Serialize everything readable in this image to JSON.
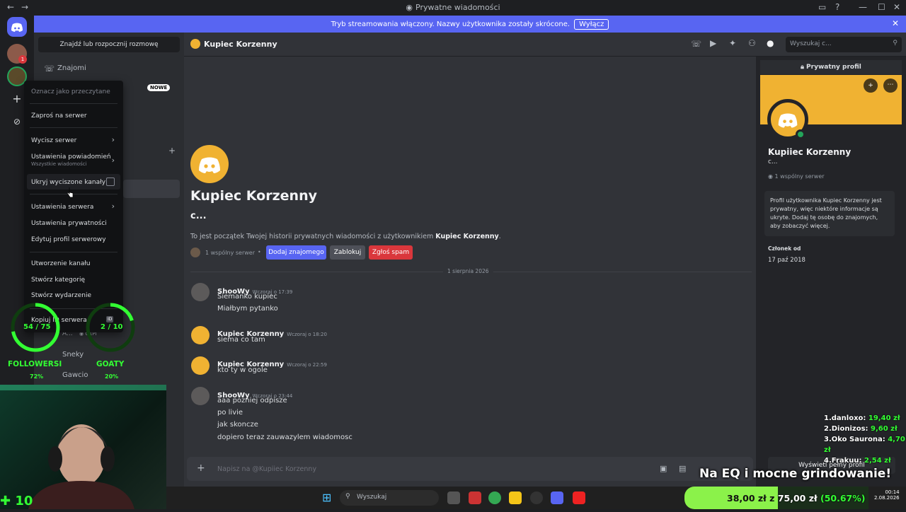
{
  "window": {
    "title": "Prywatne wiadomości"
  },
  "banner": {
    "text": "Tryb streamowania włączony. Nazwy użytkownika zostały skrócone.",
    "button": "Wyłącz"
  },
  "sidebar": {
    "search_button": "Znajdź lub rozpocznij rozmowę",
    "friends_label": "Znajomi",
    "new_badge": "NOWE",
    "list_users": [
      "A...",
      "Sneky",
      "Gawcio"
    ],
    "user_tag": "Q1PI"
  },
  "context_menu": {
    "mark_read": "Oznacz jako przeczytane",
    "invite": "Zaproś na serwer",
    "mute": "Wycisz serwer",
    "notifications": "Ustawienia powiadomień",
    "notifications_sub": "Wszystkie wiadomości",
    "hide_muted": "Ukryj wyciszone kanały",
    "server_settings": "Ustawienia serwera",
    "privacy": "Ustawienia prywatności",
    "edit_profile": "Edytuj profil serwerowy",
    "create_channel": "Utworzenie kanału",
    "create_category": "Stwórz kategorię",
    "create_event": "Stwórz wydarzenie",
    "copy_id": "Kopiuj ID serwera",
    "id_badge": "ID"
  },
  "header": {
    "name": "Kupiec Korzenny",
    "search_placeholder": "Wyszukaj c..."
  },
  "chat": {
    "intro_name": "Kupiec Korzenny",
    "intro_sub": "c...",
    "intro_text_prefix": "To jest początek Twojej historii prywatnych wiadomości z użytkownikiem ",
    "intro_text_name": "Kupiec Korzenny",
    "intro_text_suffix": ".",
    "mutual": "1 wspólny serwer",
    "add_friend": "Dodaj znajomego",
    "block": "Zablokuj",
    "report_spam": "Zgłoś spam",
    "date_divider": "1 sierpnia 2026",
    "messages": [
      {
        "author": "ShooWy",
        "time": "Wczoraj o 17:39",
        "lines": [
          "Siemanko kupiec",
          "Miałbym pytanko"
        ],
        "avatar": "user"
      },
      {
        "author": "Kupiec Korzenny",
        "time": "Wczoraj o 18:20",
        "lines": [
          "siema co tam"
        ],
        "avatar": "discord"
      },
      {
        "author": "Kupiec Korzenny",
        "time": "Wczoraj o 22:59",
        "lines": [
          "kto ty w ogole"
        ],
        "avatar": "discord"
      },
      {
        "author": "ShooWy",
        "time": "Wczoraj o 23:44",
        "lines": [
          "aaa pozniej odpisze",
          "po livie",
          "jak skoncze",
          "dopiero teraz zauwazylem wiadomosc"
        ],
        "avatar": "user"
      }
    ],
    "input_placeholder": "Napisz na @Kupiiec Korzenny"
  },
  "profile": {
    "top_label": "Prywatny profil",
    "name": "Kupiiec Korzenny",
    "sub": "c...",
    "mutual": "1 wspólny serwer",
    "info": "Profil użytkownika Kupiec Korzenny jest prywatny, więc niektóre informacje są ukryte. Dodaj tę osobę do znajomych, aby zobaczyć więcej.",
    "member_since_label": "Członek od",
    "member_since": "17 paź 2018",
    "full_profile_button": "Wyświetl pełny profil"
  },
  "overlay": {
    "followers_count": "54 / 75",
    "followers_label": "FOLLOWERSI",
    "followers_pct": "72%",
    "followers_progress": 0.72,
    "goats_count": "2 / 10",
    "goats_label": "GOATY",
    "goats_pct": "20%",
    "goats_progress": 0.2,
    "subs_count": "10",
    "leaderboard": [
      {
        "rank": "1.danloxo:",
        "amount": "19,40 zł"
      },
      {
        "rank": "2.Dionizos:",
        "amount": "9,60 zł"
      },
      {
        "rank": "3.Oko Saurona:",
        "amount": "4,70 zł"
      },
      {
        "rank": "4.Frakuu:",
        "amount": "2,54 zł"
      }
    ],
    "slogan": "Na EQ i mocne grindowanie!",
    "goal_current": "38,00 zł",
    "goal_sep": "z",
    "goal_target": "75,00 zł",
    "goal_pct": "(50.67%)",
    "goal_progress": 0.5067
  },
  "taskbar": {
    "search": "Wyszukaj",
    "time": "00:14",
    "date": "2.08.2026"
  },
  "colors": {
    "blurple": "#5865f2",
    "discord_yellow": "#f0b232",
    "danger": "#da373c",
    "overlay_green": "#33ff33"
  }
}
